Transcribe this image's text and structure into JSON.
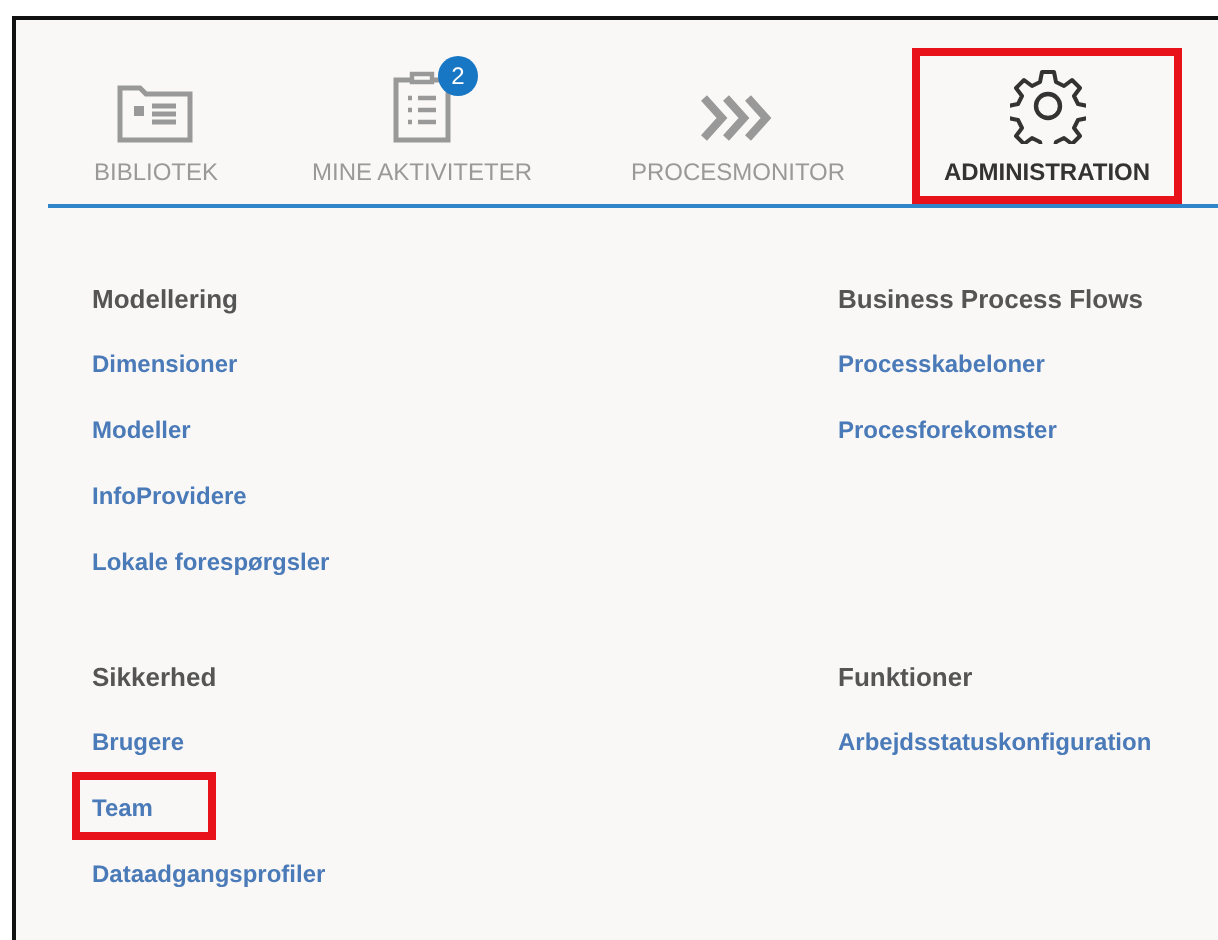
{
  "tabs": [
    {
      "label": "BIBLIOTEK",
      "kind": "library",
      "selected": false,
      "highlighted": false
    },
    {
      "label": "MINE AKTIVITETER",
      "kind": "tasks",
      "selected": false,
      "highlighted": false,
      "badge": "2"
    },
    {
      "label": "PROCESMONITOR",
      "kind": "monitor",
      "selected": false,
      "highlighted": false
    },
    {
      "label": "ADMINISTRATION",
      "kind": "settings",
      "selected": true,
      "highlighted": true
    }
  ],
  "sections": [
    {
      "title": "Modellering",
      "links": [
        {
          "label": "Dimensioner",
          "highlighted": false
        },
        {
          "label": "Modeller",
          "highlighted": false
        },
        {
          "label": "InfoProvidere",
          "highlighted": false
        },
        {
          "label": "Lokale forespørgsler",
          "highlighted": false
        }
      ]
    },
    {
      "title": "Business Process Flows",
      "links": [
        {
          "label": "Processkabeloner",
          "highlighted": false
        },
        {
          "label": "Procesforekomster",
          "highlighted": false
        }
      ]
    },
    {
      "title": "Sikkerhed",
      "links": [
        {
          "label": "Brugere",
          "highlighted": false
        },
        {
          "label": "Team",
          "highlighted": true
        },
        {
          "label": "Dataadgangsprofiler",
          "highlighted": false
        }
      ]
    },
    {
      "title": "Funktioner",
      "links": [
        {
          "label": "Arbejdsstatuskonfiguration",
          "highlighted": false
        }
      ]
    }
  ]
}
